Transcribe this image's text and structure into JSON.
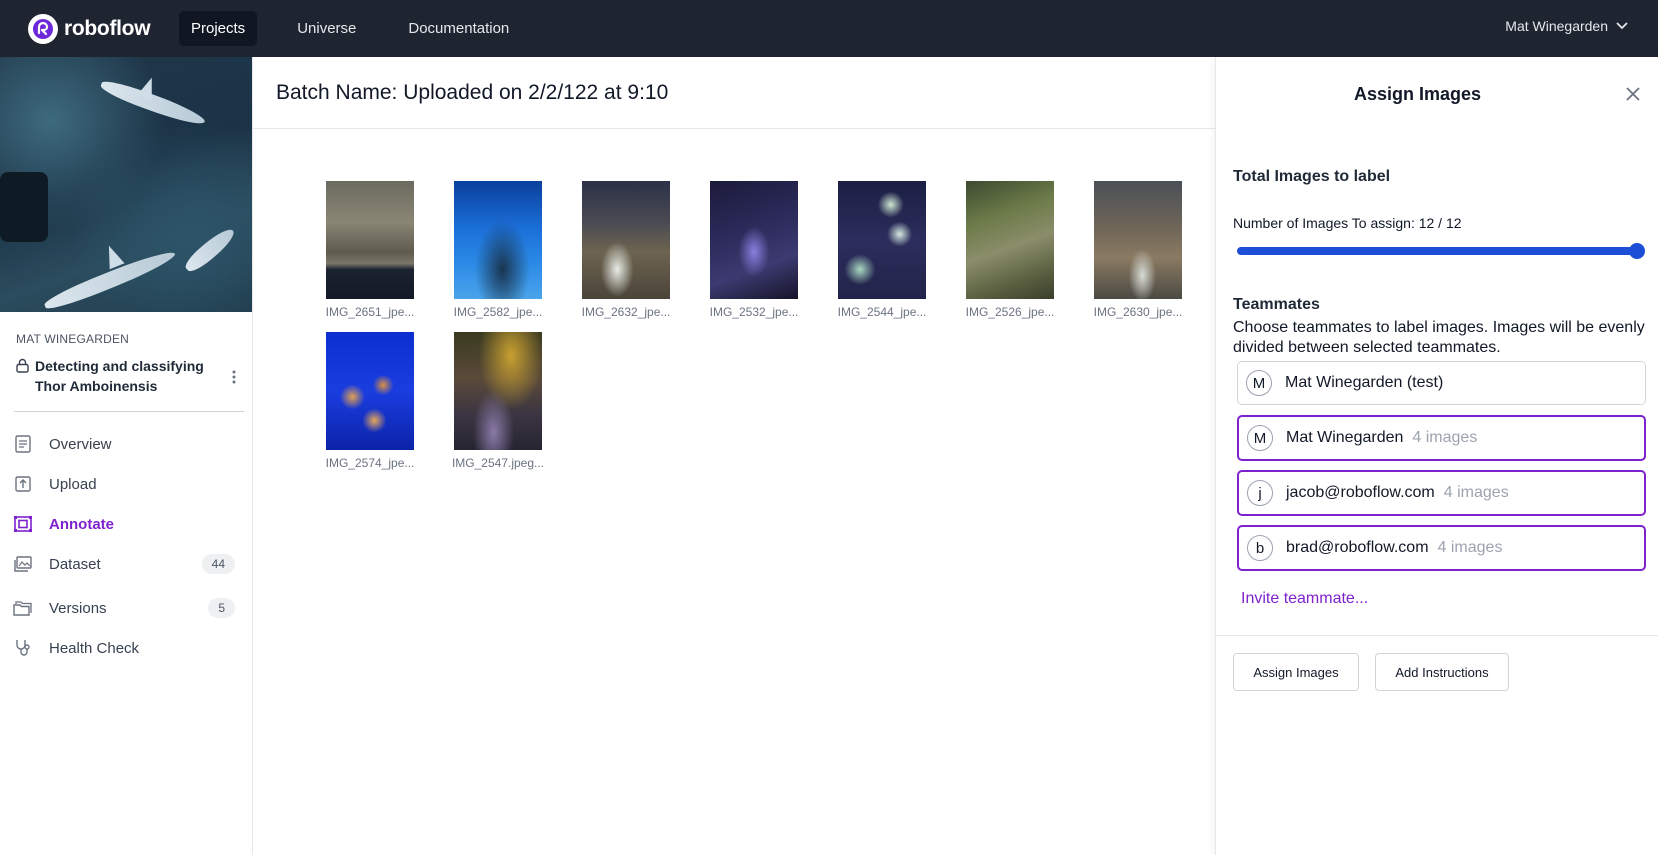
{
  "topbar": {
    "logo_text": "roboflow",
    "nav": [
      {
        "label": "Projects",
        "active": true
      },
      {
        "label": "Universe",
        "active": false
      },
      {
        "label": "Documentation",
        "active": false
      }
    ],
    "user_name": "Mat Winegarden"
  },
  "sidebar": {
    "owner": "MAT WINEGARDEN",
    "project_title": "Detecting and classifying Thor Amboinensis",
    "items": [
      {
        "label": "Overview",
        "icon": "document-icon",
        "active": false,
        "badge": ""
      },
      {
        "label": "Upload",
        "icon": "upload-icon",
        "active": false,
        "badge": ""
      },
      {
        "label": "Annotate",
        "icon": "annotate-icon",
        "active": true,
        "badge": ""
      },
      {
        "label": "Dataset",
        "icon": "images-icon",
        "active": false,
        "badge": "44"
      },
      {
        "label": "Versions",
        "icon": "folders-icon",
        "active": false,
        "badge": "5"
      },
      {
        "label": "Health Check",
        "icon": "stethoscope-icon",
        "active": false,
        "badge": ""
      }
    ]
  },
  "main": {
    "batch_title": "Batch Name: Uploaded on 2/2/122 at 9:10",
    "images": [
      {
        "caption": "IMG_2651_jpe..."
      },
      {
        "caption": "IMG_2582_jpe..."
      },
      {
        "caption": "IMG_2632_jpe..."
      },
      {
        "caption": "IMG_2532_jpe..."
      },
      {
        "caption": "IMG_2544_jpe..."
      },
      {
        "caption": "IMG_2526_jpe..."
      },
      {
        "caption": "IMG_2630_jpe..."
      },
      {
        "caption": "IMG_2574_jpe..."
      },
      {
        "caption": "IMG_2547.jpeg..."
      }
    ]
  },
  "drawer": {
    "title": "Assign Images",
    "total_label": "Total Images to label",
    "assign_count_label": "Number of Images To assign: 12 / 12",
    "slider_value": 12,
    "slider_max": 12,
    "teammates_heading": "Teammates",
    "teammates_description": "Choose teammates to label images. Images will be evenly divided between selected teammates.",
    "teammates": [
      {
        "initial": "M",
        "name": "Mat Winegarden (test)",
        "count": "",
        "selected": false
      },
      {
        "initial": "M",
        "name": "Mat Winegarden",
        "count": "4 images",
        "selected": true
      },
      {
        "initial": "j",
        "name": "jacob@roboflow.com",
        "count": "4 images",
        "selected": true
      },
      {
        "initial": "b",
        "name": "brad@roboflow.com",
        "count": "4 images",
        "selected": true
      }
    ],
    "invite_label": "Invite teammate...",
    "assign_button": "Assign Images",
    "instructions_button": "Add Instructions"
  },
  "colors": {
    "accent": "#7e22ce",
    "slider": "#1d4ed8",
    "topbar": "#1f2530"
  }
}
